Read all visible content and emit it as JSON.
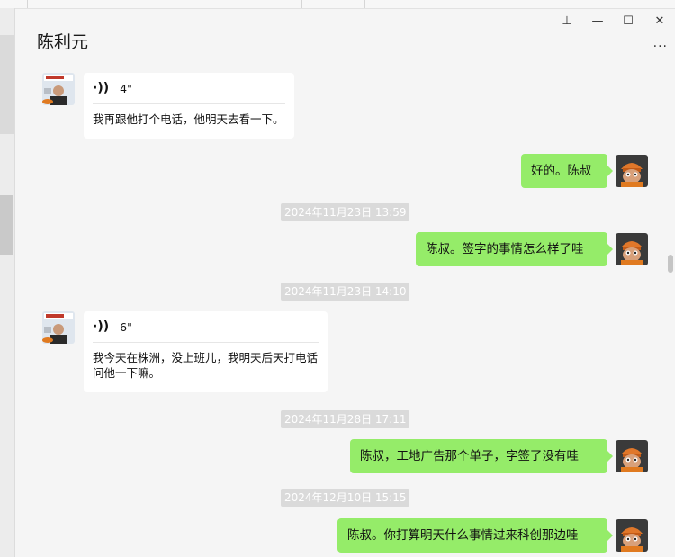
{
  "window": {
    "title": "陈利元",
    "pin": "⊥",
    "minimize": "—",
    "maximize": "☐",
    "close": "✕",
    "more": "···"
  },
  "messages": {
    "m1": {
      "duration": "4\"",
      "transcript": "我再跟他打个电话，他明天去看一下。"
    },
    "m2": {
      "text": "好的。陈叔"
    },
    "ts1": "2024年11月23日 13:59",
    "m3": {
      "text": "陈叔。签字的事情怎么样了哇"
    },
    "ts2": "2024年11月23日 14:10",
    "m4": {
      "duration": "6\"",
      "transcript": "我今天在株洲，没上班儿，我明天后天打电话问他一下嘛。"
    },
    "ts3": "2024年11月28日 17:11",
    "m5": {
      "text": "陈叔，工地广告那个单子，字签了没有哇"
    },
    "ts4": "2024年12月10日 15:15",
    "m6": {
      "text": "陈叔。你打算明天什么事情过来科创那边哇"
    }
  },
  "colors": {
    "outgoing_bubble": "#95ec69",
    "incoming_bubble": "#ffffff",
    "background": "#f5f5f5"
  }
}
